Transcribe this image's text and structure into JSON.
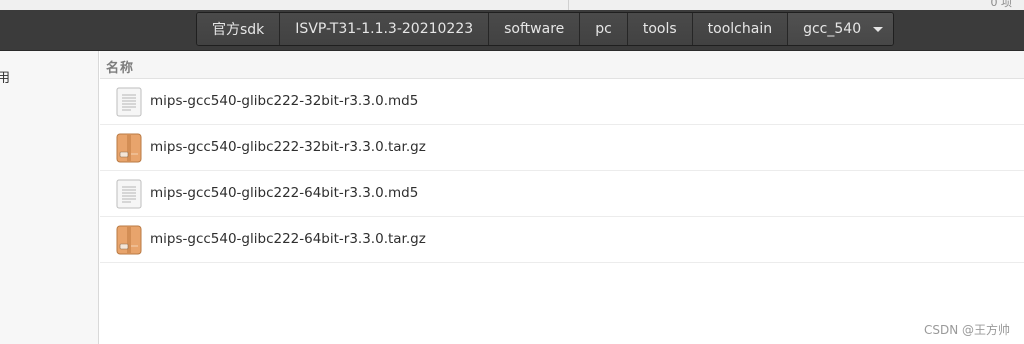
{
  "top_right_partial_text": "0 项",
  "breadcrumbs": [
    {
      "label": "官方sdk"
    },
    {
      "label": "ISVP-T31-1.1.3-20210223"
    },
    {
      "label": "software"
    },
    {
      "label": "pc"
    },
    {
      "label": "tools"
    },
    {
      "label": "toolchain"
    },
    {
      "label": "gcc_540"
    }
  ],
  "sidebar": {
    "partial_label": "用"
  },
  "list": {
    "column_name": "名称",
    "files": [
      {
        "name": "mips-gcc540-glibc222-32bit-r3.3.0.md5",
        "icon": "text-document-icon"
      },
      {
        "name": "mips-gcc540-glibc222-32bit-r3.3.0.tar.gz",
        "icon": "archive-icon"
      },
      {
        "name": "mips-gcc540-glibc222-64bit-r3.3.0.md5",
        "icon": "text-document-icon"
      },
      {
        "name": "mips-gcc540-glibc222-64bit-r3.3.0.tar.gz",
        "icon": "archive-icon"
      }
    ]
  },
  "watermark": "CSDN @王方帅",
  "colors": {
    "headerbar": "#3b3b3b",
    "archive_icon": "#e8a46c",
    "text_icon": "#f4f4f4"
  }
}
